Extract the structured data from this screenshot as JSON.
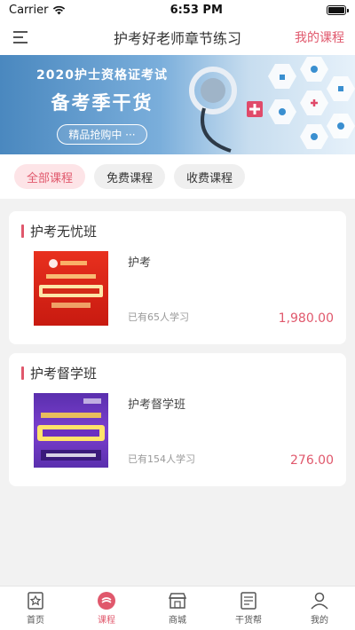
{
  "status_bar": {
    "carrier": "Carrier",
    "time": "6:53 PM",
    "battery_level": 1.0
  },
  "nav": {
    "title": "护考好老师章节练习",
    "right_label": "我的课程"
  },
  "banner": {
    "title": "2020护士资格证考试",
    "subtitle": "备考季干货",
    "button": "精品抢购中 ···"
  },
  "filters": [
    {
      "label": "全部课程",
      "active": true
    },
    {
      "label": "免费课程",
      "active": false
    },
    {
      "label": "收费课程",
      "active": false
    }
  ],
  "courses": [
    {
      "title": "护考无忧班",
      "name": "护考",
      "learners": "已有65人学习",
      "price": "1,980.00"
    },
    {
      "title": "护考督学班",
      "name": "护考督学班",
      "learners": "已有154人学习",
      "price": "276.00"
    }
  ],
  "tabs": [
    {
      "label": "首页",
      "icon": "home-icon"
    },
    {
      "label": "课程",
      "icon": "course-icon",
      "active": true
    },
    {
      "label": "商城",
      "icon": "shop-icon"
    },
    {
      "label": "干货帮",
      "icon": "notes-icon"
    },
    {
      "label": "我的",
      "icon": "profile-icon"
    }
  ],
  "colors": {
    "accent": "#e0586c",
    "chip_active_bg": "#fde4e7",
    "banner_blue": "#4a88bf"
  }
}
